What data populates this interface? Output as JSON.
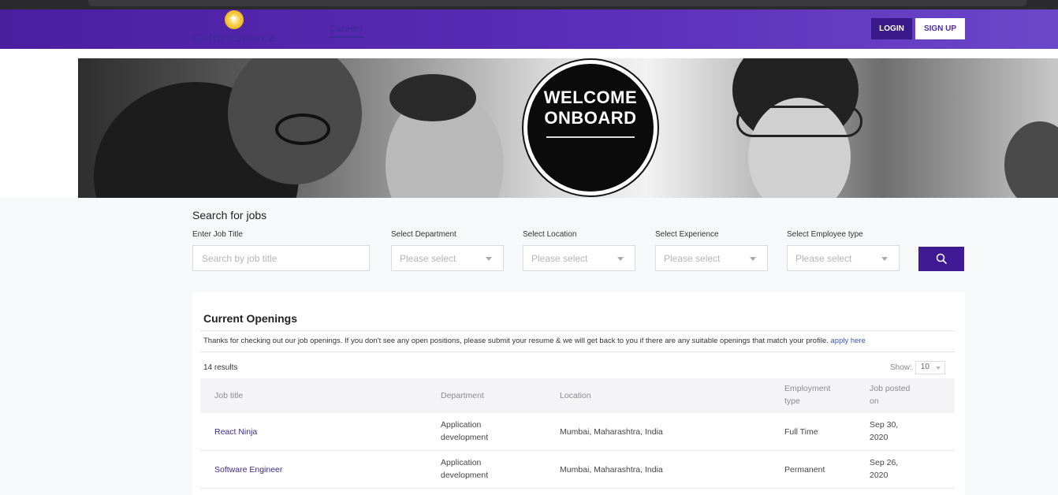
{
  "header": {
    "logo_text": "GoldenSource",
    "nav_careers": "Careers",
    "login_label": "LOGIN",
    "signup_label": "SIGN UP",
    "brand_color": "#5b2db8"
  },
  "hero": {
    "badge_line1": "WELCOME",
    "badge_line2": "ONBOARD"
  },
  "search": {
    "title": "Search for jobs",
    "job_title_label": "Enter Job Title",
    "job_title_placeholder": "Search by job title",
    "department_label": "Select Department",
    "department_value": "Please select",
    "location_label": "Select Location",
    "location_value": "Please select",
    "experience_label": "Select Experience",
    "experience_value": "Please select",
    "employee_type_label": "Select Employee type",
    "employee_type_value": "Please select",
    "search_icon": "search-icon"
  },
  "openings": {
    "title": "Current Openings",
    "message": "Thanks for checking out our job openings. If you don't see any open positions, please submit your resume & we will get back to you if there are any suitable openings that match your profile.",
    "apply_link": "apply here",
    "results": "14 results",
    "show_label": "Show:",
    "show_value": "10",
    "columns": {
      "job_title": "Job title",
      "department": "Department",
      "location": "Location",
      "employment_type_1": "Employment",
      "employment_type_2": "type",
      "posted_1": "Job posted",
      "posted_2": "on"
    },
    "rows": [
      {
        "job_title": "React Ninja",
        "department_1": "Application",
        "department_2": "development",
        "location": "Mumbai, Maharashtra, India",
        "employment_type": "Full Time",
        "posted_1": "Sep 30,",
        "posted_2": "2020"
      },
      {
        "job_title": "Software Engineer",
        "department_1": "Application",
        "department_2": "development",
        "location": "Mumbai, Maharashtra, India",
        "employment_type": "Permanent",
        "posted_1": "Sep 26,",
        "posted_2": "2020"
      }
    ]
  }
}
